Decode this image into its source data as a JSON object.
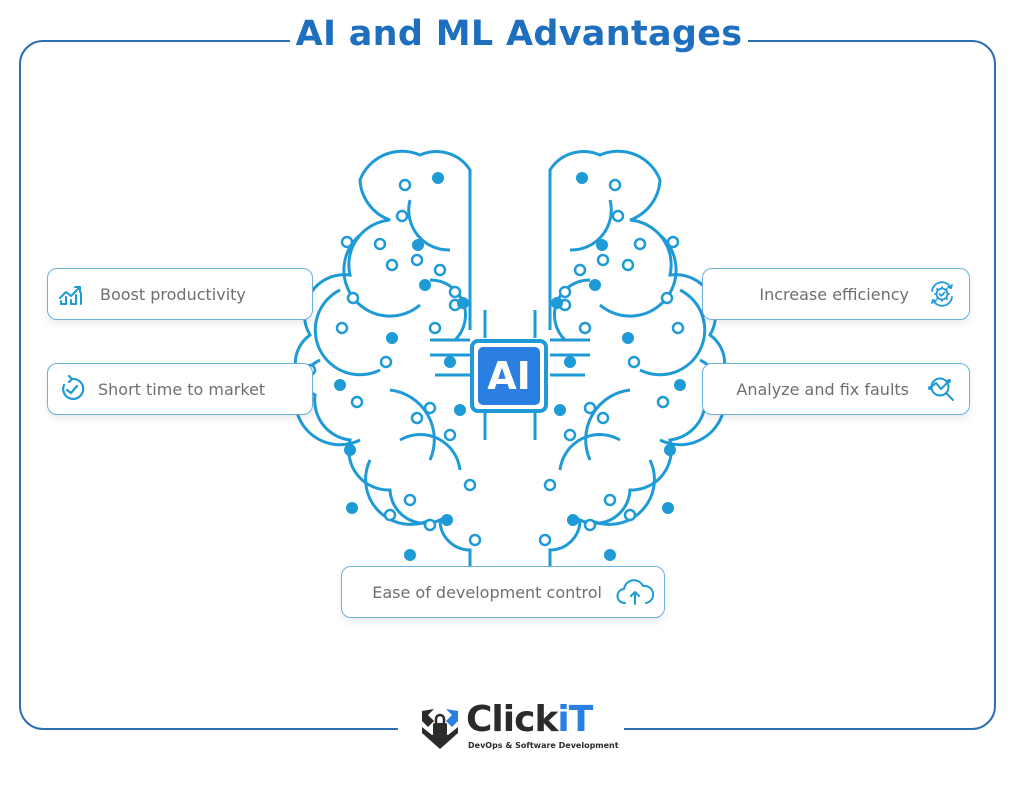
{
  "title": "AI and ML Advantages",
  "center_chip": {
    "label": "AI"
  },
  "advantages": [
    {
      "label": "Boost productivity",
      "icon": "trending-up-chart-icon",
      "side": "left"
    },
    {
      "label": "Short time to market",
      "icon": "clock-check-icon",
      "side": "left"
    },
    {
      "label": "Increase efficiency",
      "icon": "gear-cycle-icon",
      "side": "right"
    },
    {
      "label": "Analyze and fix faults",
      "icon": "search-analytics-icon",
      "side": "right"
    },
    {
      "label": "Ease of development control",
      "icon": "cloud-upload-icon",
      "side": "bottom"
    }
  ],
  "logo": {
    "name_main": "Click",
    "name_accent": "iT",
    "tagline": "DevOps & Software Development"
  },
  "colors": {
    "title": "#1f6fbf",
    "frame": "#2f6fae",
    "circuit": "#1e9ad6",
    "chip": "#2a7fe0",
    "text": "#6f6f6f"
  }
}
